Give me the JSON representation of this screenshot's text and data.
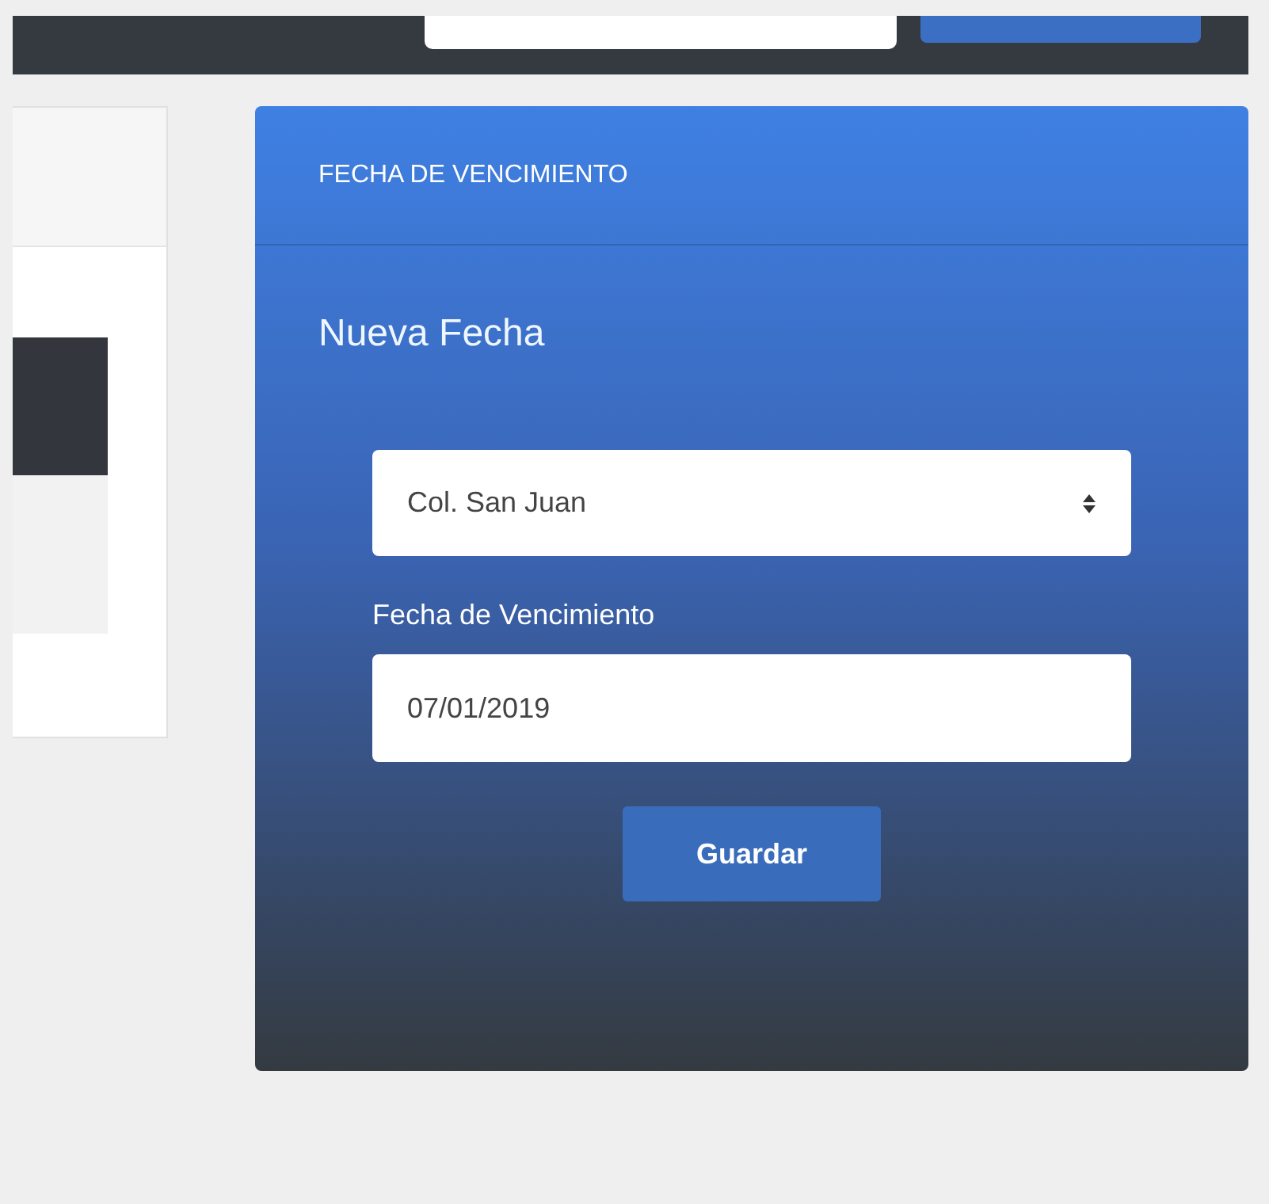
{
  "panel": {
    "title": "FECHA DE VENCIMIENTO",
    "heading": "Nueva Fecha",
    "select": {
      "value": "Col. San Juan"
    },
    "date_field": {
      "label": "Fecha de Vencimiento",
      "value": "07/01/2019"
    },
    "button": "Guardar"
  }
}
